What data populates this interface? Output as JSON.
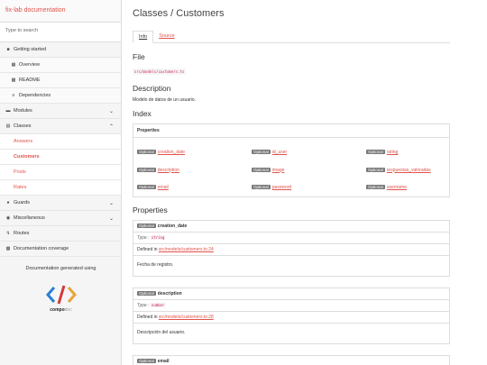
{
  "sidebar": {
    "brand": "fix-lab documentation",
    "search_placeholder": "Type to search",
    "items": [
      {
        "label": "Getting started",
        "icon": "home-icon"
      },
      {
        "label": "Overview",
        "icon": "grid-icon"
      },
      {
        "label": "README",
        "icon": "book-icon"
      },
      {
        "label": "Dependencies",
        "icon": "list-icon"
      },
      {
        "label": "Modules",
        "icon": "archive-icon"
      },
      {
        "label": "Classes",
        "icon": "file-icon"
      },
      {
        "label": "Answers"
      },
      {
        "label": "Customers"
      },
      {
        "label": "Posts"
      },
      {
        "label": "Rates"
      },
      {
        "label": "Guards",
        "icon": "lock-icon"
      },
      {
        "label": "Miscellaneous",
        "icon": "globe-icon"
      },
      {
        "label": "Routes",
        "icon": "routes-icon"
      },
      {
        "label": "Documentation coverage",
        "icon": "chart-icon"
      }
    ],
    "footer": "Documentation generated using",
    "logo_text_bold": "compo",
    "logo_text_light": "doc"
  },
  "main": {
    "breadcrumb": "Classes  /  Customers",
    "tabs": [
      "Info",
      "Source"
    ],
    "file_heading": "File",
    "file_path": "src/models/customers.ts",
    "description_heading": "Description",
    "description": "Modelo de datos de un usuario.",
    "index_heading": "Index",
    "index_panel_title": "Properties",
    "badge": "Optional",
    "index_props": [
      "creation_date",
      "id_user",
      "rating",
      "description",
      "image",
      "respuestas_valoradas",
      "email",
      "password",
      "username"
    ],
    "properties_heading": "Properties",
    "type_label": "Type : ",
    "defined_label": "Defined in ",
    "prop_cards": [
      {
        "name": "creation_date",
        "type": "string",
        "defined": "src/models/customers.ts:24",
        "desc": "Fecha de registro."
      },
      {
        "name": "description",
        "type": "number",
        "defined": "src/models/customers.ts:28",
        "desc": "Descripción del usuario."
      },
      {
        "name": "email"
      }
    ]
  },
  "colors": {
    "accent": "#e0534a",
    "badge": "#777777",
    "sidebar_bg": "#f5f5f5"
  }
}
